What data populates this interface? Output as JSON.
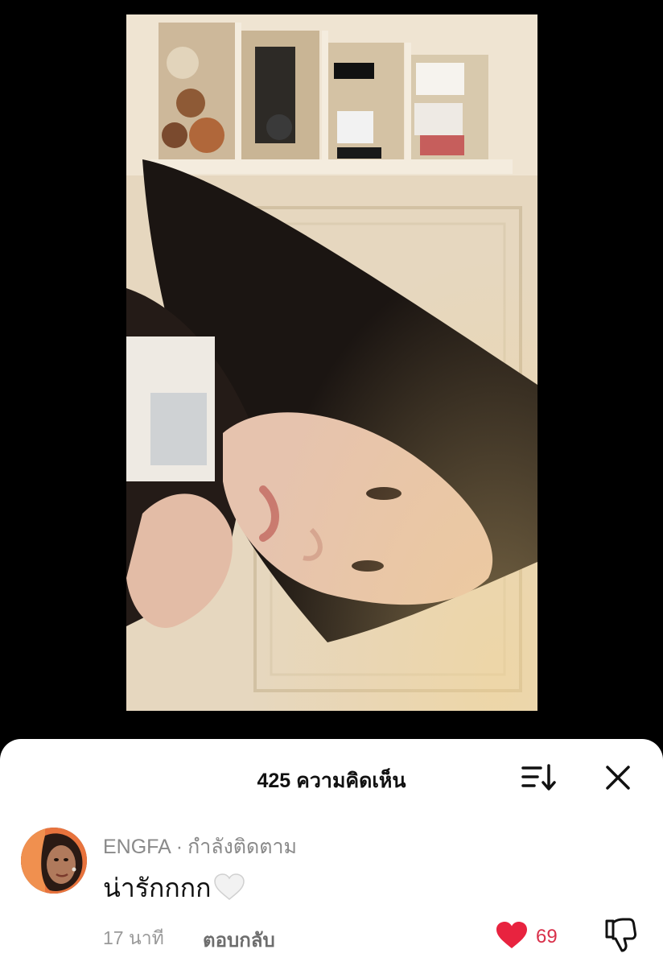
{
  "comments_panel": {
    "title": "425 ความคิดเห็น",
    "sort_icon": "sort-descending-icon",
    "close_icon": "close-icon"
  },
  "comment": {
    "username": "ENGFA",
    "separator": "·",
    "follow_status": "กำลังติดตาม",
    "text": "น่ารักกกก",
    "emoji": "white-heart-emoji",
    "time": "17 นาที",
    "reply_label": "ตอบกลับ",
    "like_count": "69",
    "liked": true,
    "like_color": "#e8233f",
    "like_icon": "heart-filled-icon",
    "dislike_icon": "thumbs-down-icon"
  },
  "video": {
    "description_icon": "video-frame"
  }
}
